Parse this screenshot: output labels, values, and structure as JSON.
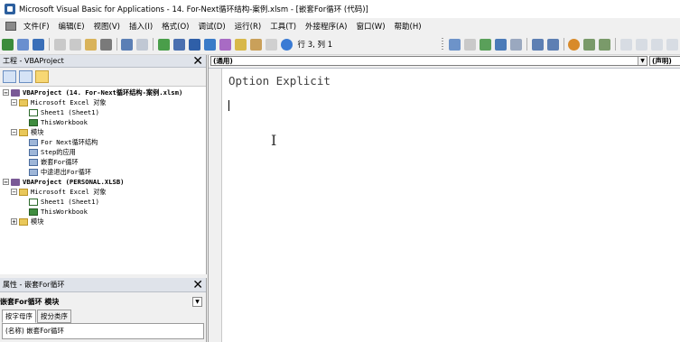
{
  "window": {
    "title": "Microsoft Visual Basic for Applications - 14. For-Next循环结构-案例.xlsm - [嵌套For循环 (代码)]"
  },
  "menu": [
    "文件(F)",
    "编辑(E)",
    "视图(V)",
    "插入(I)",
    "格式(O)",
    "调试(D)",
    "运行(R)",
    "工具(T)",
    "外接程序(A)",
    "窗口(W)",
    "帮助(H)"
  ],
  "toolbar": {
    "position": "行 3, 列 1"
  },
  "project_explorer": {
    "title": "工程 - VBAProject",
    "nodes": [
      {
        "text": "VBAProject (14. For-Next循环结构-案例.xlsm)",
        "bold": true
      },
      {
        "text": "Microsoft Excel 对象"
      },
      {
        "text": "Sheet1 (Sheet1)"
      },
      {
        "text": "ThisWorkbook"
      },
      {
        "text": "模块"
      },
      {
        "text": "For Next循环结构"
      },
      {
        "text": "Step的应用"
      },
      {
        "text": "嵌套For循环"
      },
      {
        "text": "中途退出For循环"
      },
      {
        "text": "VBAProject (PERSONAL.XLSB)",
        "bold": true
      },
      {
        "text": "Microsoft Excel 对象"
      },
      {
        "text": "Sheet1 (Sheet1)"
      },
      {
        "text": "ThisWorkbook"
      },
      {
        "text": "模块"
      }
    ]
  },
  "properties": {
    "title": "属性 - 嵌套For循环",
    "object": "嵌套For循环 模块",
    "tabs": [
      "按字母序",
      "按分类序"
    ],
    "row": "(名称) 嵌套For循环"
  },
  "code_window": {
    "object_combo": "(通用)",
    "proc_combo": "(声明)",
    "lines": [
      "Option Explicit"
    ]
  },
  "colors": {
    "title_bg": "#ffffff",
    "chrome": "#f0f0f0",
    "panel_head": "#dfe3ea"
  }
}
